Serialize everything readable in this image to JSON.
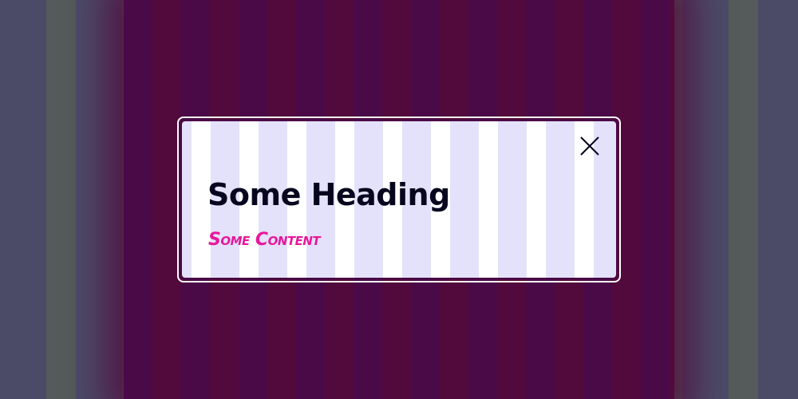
{
  "dialog": {
    "heading": "Some Heading",
    "content": "Some Content",
    "close_icon": "close-icon"
  },
  "colors": {
    "heading": "#06061f",
    "content_accent": "#e8179c",
    "overlay": "#520a3c",
    "dialog_border": "#ffffff",
    "dialog_stripe": "#e4e2fb"
  }
}
